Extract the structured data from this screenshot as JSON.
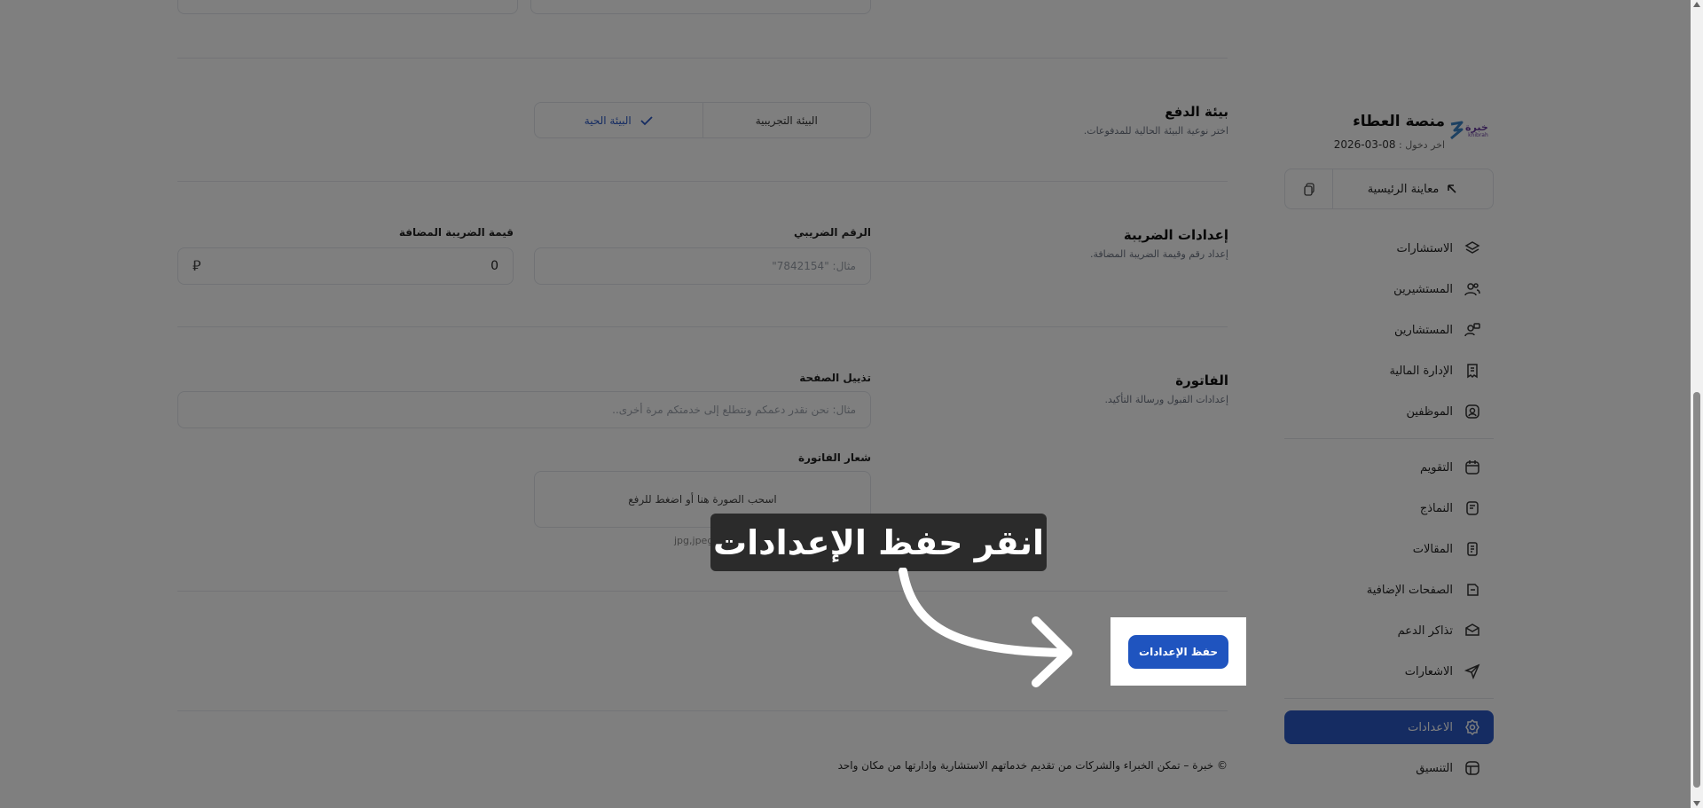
{
  "brand": {
    "logo_text": "خبرة",
    "logo_sub": "khibrah",
    "title": "منصة العطاء",
    "last_login_label": "اخر دخول :",
    "last_login_date": "08-03-2026"
  },
  "sidebar": {
    "preview_label": "معاينة الرئيسية",
    "items": [
      {
        "label": "الاستشارات",
        "icon": "layers-icon"
      },
      {
        "label": "المستشيرين",
        "icon": "users-icon"
      },
      {
        "label": "المستشارين",
        "icon": "user-chat-icon"
      },
      {
        "label": "الإدارة المالية",
        "icon": "receipt-icon"
      },
      {
        "label": "الموظفين",
        "icon": "user-square-icon"
      },
      {
        "label": "التقويم",
        "icon": "calendar-icon"
      },
      {
        "label": "النماذج",
        "icon": "form-icon"
      },
      {
        "label": "المقالات",
        "icon": "article-icon"
      },
      {
        "label": "الصفحات الإضافية",
        "icon": "pages-icon"
      },
      {
        "label": "تذاكر الدعم",
        "icon": "ticket-icon"
      },
      {
        "label": "الاشعارات",
        "icon": "send-icon"
      },
      {
        "label": "الاعدادات",
        "icon": "gear-icon",
        "active": true
      },
      {
        "label": "التنسيق",
        "icon": "layout-icon"
      }
    ]
  },
  "payment": {
    "title": "بيئة الدفع",
    "desc": "اختر نوعية البيئة الحالية للمدفوعات.",
    "option_test": "البيئة التجريبية",
    "option_live": "البيئة الحية",
    "selected": "live"
  },
  "tax": {
    "title": "إعدادات الضريبة",
    "desc": "إعداد رقم وقيمة الضريبة المضافة.",
    "number_label": "الرقم الضريبي",
    "number_placeholder": "مثال: \"7842154\"",
    "vat_label": "قيمة الضريبة المضافة",
    "vat_value": "0",
    "currency_symbol": "⃁"
  },
  "invoice": {
    "title": "الفاتورة",
    "desc": "إعدادات القبول ورسالة التأكيد.",
    "footer_label": "تذييل الصفحة",
    "footer_placeholder": "مثال: نحن نقدر دعمكم ونتطلع إلى خدمتكم مرة أخرى..",
    "logo_label": "شعار الفاتورة",
    "dropzone_text": "اسحب الصورة هنا أو اضغط للرفع",
    "formats": "jpg,jpeg,png"
  },
  "actions": {
    "save_label": "حفظ الإعدادات"
  },
  "tutorial": {
    "callout": "انقر حفظ الإعدادات"
  },
  "footer": {
    "text": "© خبرة – تمكن الخبراء والشركات من تقديم خدماتهم الاستشارية وإدارتها من مكان واحد"
  },
  "colors": {
    "accent": "#2a58c5",
    "save_button": "#1f54bf"
  }
}
